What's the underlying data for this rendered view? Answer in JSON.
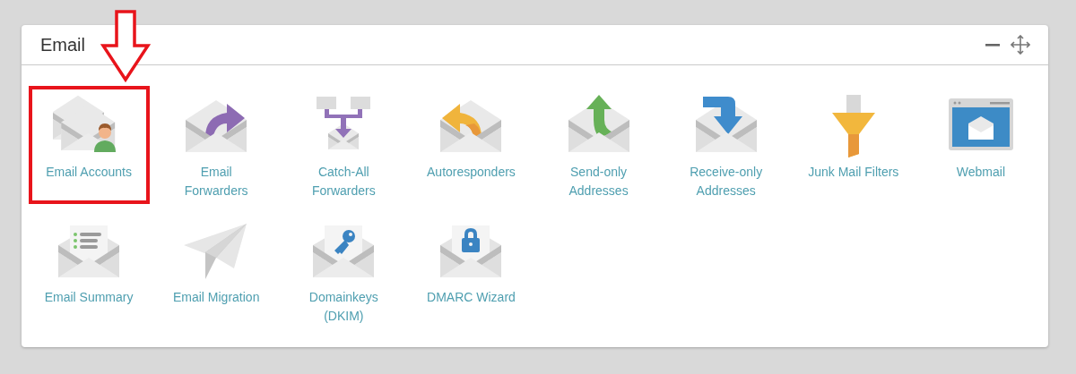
{
  "panel": {
    "title": "Email",
    "controls": [
      {
        "kind": "minimize"
      },
      {
        "kind": "move"
      }
    ]
  },
  "items": [
    {
      "kind": "accounts",
      "label": "Email Accounts",
      "highlighted": true
    },
    {
      "kind": "forwarders",
      "label": "Email Forwarders",
      "highlighted": false
    },
    {
      "kind": "catch-all",
      "label": "Catch-All Forwarders",
      "highlighted": false
    },
    {
      "kind": "autoresponders",
      "label": "Autoresponders",
      "highlighted": false
    },
    {
      "kind": "send-only",
      "label": "Send-only Addresses",
      "highlighted": false
    },
    {
      "kind": "receive-only",
      "label": "Receive-only Addresses",
      "highlighted": false
    },
    {
      "kind": "junk-filter",
      "label": "Junk Mail Filters",
      "highlighted": false
    },
    {
      "kind": "webmail",
      "label": "Webmail",
      "highlighted": false
    },
    {
      "kind": "summary",
      "label": "Email Summary",
      "highlighted": false
    },
    {
      "kind": "migration",
      "label": "Email Migration",
      "highlighted": false
    },
    {
      "kind": "dkim",
      "label": "Domainkeys (DKIM)",
      "highlighted": false
    },
    {
      "kind": "dmarc",
      "label": "DMARC Wizard",
      "highlighted": false
    }
  ]
}
